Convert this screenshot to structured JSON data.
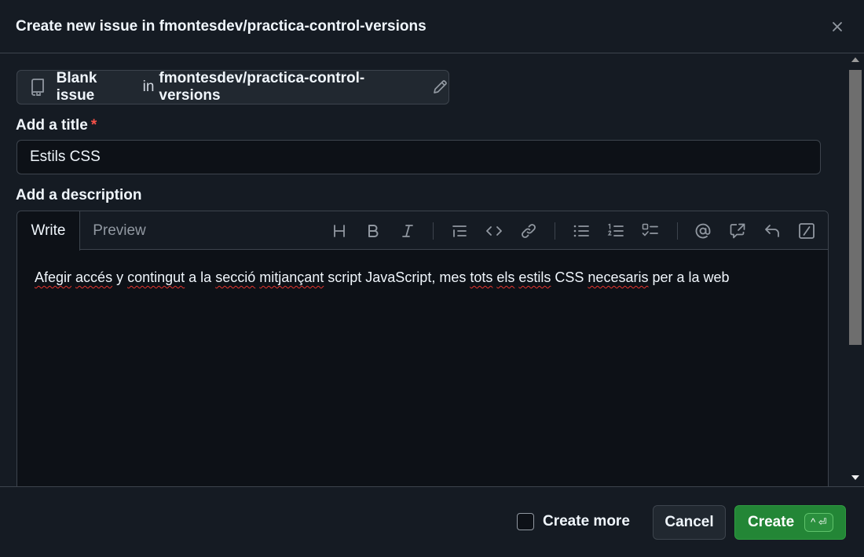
{
  "header": {
    "title": "Create new issue in fmontesdev/practica-control-versions"
  },
  "template": {
    "name": "Blank issue",
    "in_word": "in",
    "repo": "fmontesdev/practica-control-versions"
  },
  "title_field": {
    "label": "Add a title",
    "required_mark": "*",
    "value": "Estils CSS"
  },
  "description": {
    "label": "Add a description",
    "tabs": {
      "write": "Write",
      "preview": "Preview"
    },
    "toolbar_icons": [
      "heading-icon",
      "bold-icon",
      "italic-icon",
      "quote-icon",
      "code-icon",
      "link-icon",
      "bulleted-list-icon",
      "numbered-list-icon",
      "task-list-icon",
      "mention-icon",
      "reference-icon",
      "saved-replies-icon",
      "slash-commands-icon"
    ],
    "text_parts": [
      "Afegir",
      " ",
      "accés",
      " y ",
      "contingut",
      " a la ",
      "secció",
      " ",
      "mitjançant",
      " script JavaScript, mes ",
      "tots",
      " ",
      "els",
      " ",
      "estils",
      " CSS ",
      "necesaris",
      " per a la web"
    ]
  },
  "footer": {
    "create_more_label": "Create more",
    "cancel_label": "Cancel",
    "create_label": "Create",
    "create_shortcut": "^ ⏎"
  },
  "colors": {
    "background": "#151b23",
    "input_bg": "#0d1117",
    "border": "#3d444d",
    "primary_button": "#238636",
    "required": "#f85149"
  }
}
